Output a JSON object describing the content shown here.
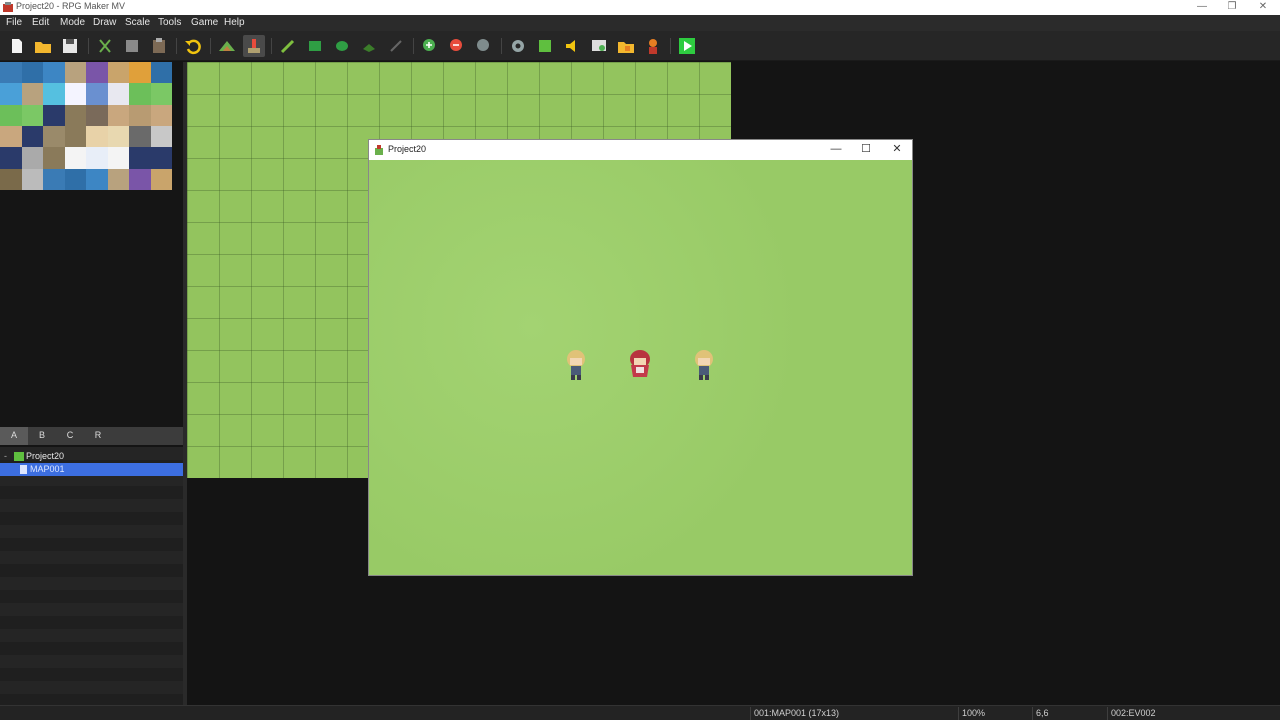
{
  "window": {
    "title": "Project20 - RPG Maker MV",
    "minimize": "—",
    "restore": "❐",
    "close": "✕"
  },
  "menu": [
    "File",
    "Edit",
    "Mode",
    "Draw",
    "Scale",
    "Tools",
    "Game",
    "Help"
  ],
  "toolbar": {
    "icons": [
      "new-project-icon",
      "open-project-icon",
      "save-project-icon",
      "cut-icon",
      "copy-icon",
      "paste-icon",
      "undo-icon",
      "map-mode-icon",
      "event-mode-icon",
      "pencil-icon",
      "rectangle-icon",
      "ellipse-icon",
      "fill-icon",
      "shadow-pen-icon",
      "zoom-in-icon",
      "zoom-out-icon",
      "actual-size-icon",
      "database-icon",
      "plugin-manager-icon",
      "sound-test-icon",
      "event-searcher-icon",
      "resource-manager-icon",
      "character-generator-icon",
      "playtest-icon"
    ]
  },
  "tabs": [
    "A",
    "B",
    "C",
    "R"
  ],
  "map_tree": {
    "project": "Project20",
    "maps": [
      "MAP001"
    ],
    "selected_map": "MAP001"
  },
  "game_window": {
    "title": "Project20",
    "minimize": "—",
    "maximize": "☐",
    "close": "✕"
  },
  "status": {
    "map": "001:MAP001 (17x13)",
    "zoom": "100%",
    "coords": "6,6",
    "event": "002:EV002"
  },
  "colors": {
    "grass": "#9bcf6a",
    "map_grass": "#93c45e",
    "selection": "#3c6ee0",
    "background": "#141414"
  }
}
